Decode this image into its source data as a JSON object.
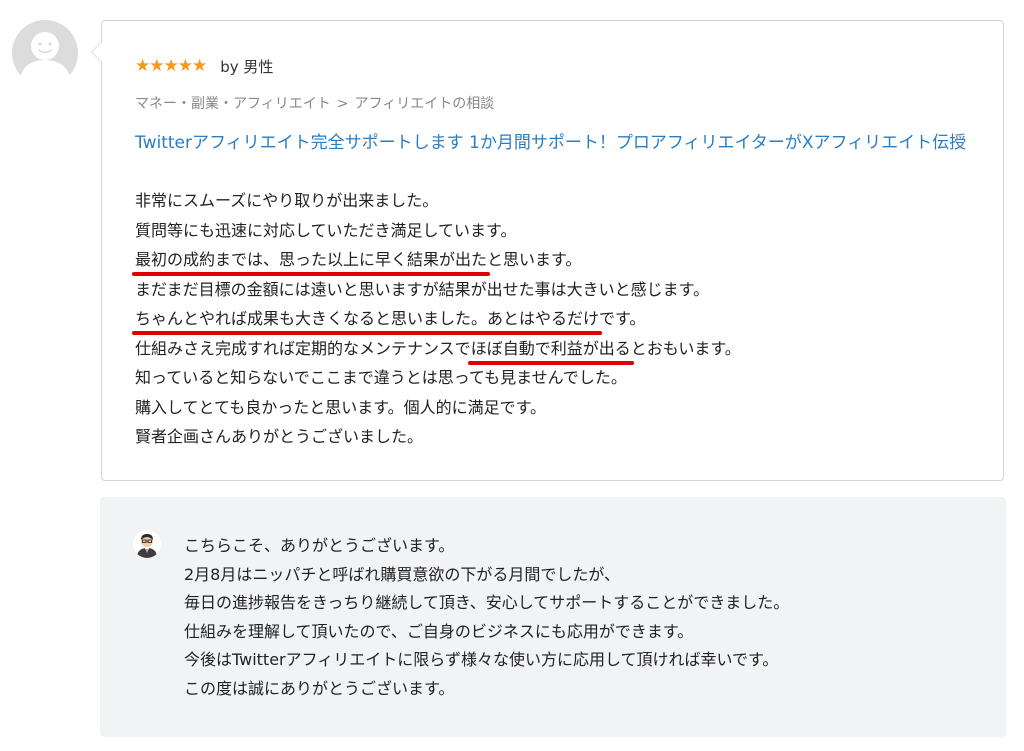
{
  "review": {
    "rating": 5,
    "stars": [
      "★",
      "★",
      "★",
      "★",
      "★"
    ],
    "by": "by 男性",
    "category": [
      "マネー・副業・アフィリエイト",
      ">",
      "アフィリエイトの相談"
    ],
    "service_title": "Twitterアフィリエイト完全サポートします 1か月間サポート！プロアフィリエイターがXアフィリエイト伝授",
    "lines": [
      {
        "segments": [
          {
            "text": "非常にスムーズにやり取りが出来ました。"
          }
        ]
      },
      {
        "segments": [
          {
            "text": "質問等にも迅速に対応していただき満足しています。"
          }
        ]
      },
      {
        "segments": [
          {
            "text": "最初の成約までは、思った以上に早く結果が出た",
            "mark": true
          },
          {
            "text": "と思います。"
          }
        ]
      },
      {
        "segments": [
          {
            "text": "まだまだ目標の金額には遠いと思いますが結果が出せた事は大きいと感じます。"
          }
        ]
      },
      {
        "segments": [
          {
            "text": "ちゃんとやれば成果も大きくなると思いました。あとはやるだけ",
            "mark": true
          },
          {
            "text": "です。"
          }
        ]
      },
      {
        "segments": [
          {
            "text": "仕組みさえ完成すれば定期的なメンテナンスで"
          },
          {
            "text": "ほぼ自動で利益が出る",
            "mark": true
          },
          {
            "text": "とおもいます。"
          }
        ]
      },
      {
        "segments": [
          {
            "text": "知っていると知らないでここまで違うとは思っても見ませんでした。"
          }
        ]
      },
      {
        "segments": [
          {
            "text": "購入してとても良かったと思います。個人的に満足です。"
          }
        ]
      },
      {
        "segments": [
          {
            "text": "賢者企画さんありがとうございました。"
          }
        ]
      }
    ]
  },
  "reply": {
    "lines": [
      "こちらこそ、ありがとうございます。",
      "2月8月はニッパチと呼ばれ購買意欲の下がる月間でしたが、",
      "毎日の進捗報告をきっちり継続して頂き、安心してサポートすることができました。",
      "仕組みを理解して頂いたので、ご自身のビジネスにも応用ができます。",
      "今後はTwitterアフィリエイトに限らず様々な使い方に応用して頂ければ幸いです。",
      "この度は誠にありがとうございます。"
    ]
  },
  "colors": {
    "star": "#f39a1b",
    "link": "#2a7dc3",
    "underline": "#e00000",
    "reply_bg": "#f2f3f5"
  },
  "icons": {
    "reviewer_avatar": "default-user-avatar-icon",
    "seller_avatar": "seller-portrait-icon"
  }
}
